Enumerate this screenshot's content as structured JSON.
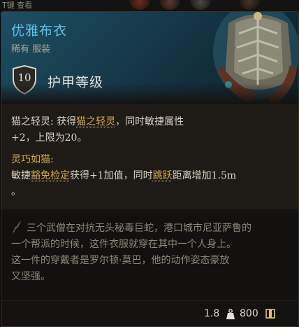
{
  "hint": {
    "key_text": "T键 查看"
  },
  "item": {
    "name": "优雅布衣",
    "rarity_type": "稀有 服装",
    "armor_class_value": "10",
    "armor_class_label": "护甲等级"
  },
  "properties": [
    {
      "title": "猫之轻灵:",
      "line1_pre": "获得",
      "line1_highlight": "猫之轻灵",
      "line1_post": "，同时敏捷属性",
      "line2": "+2，上限为20。"
    },
    {
      "title": "灵巧如猫:",
      "line1_pre": "敏捷",
      "line1_highlight": "豁免检定",
      "line1_mid": "获得+1加值，同时",
      "line1_highlight2": "跳跃",
      "line1_post": "距离增加1.5m",
      "line2": "。"
    }
  ],
  "lore": {
    "lines": [
      "三个武僧在对抗无头秘毒巨蛇，港口城市尼亚萨鲁的",
      "一个帮派的时候，这件衣服就穿在其中一个人身上。",
      "这一件的穿戴者是罗尔顿·莫巴，他的动作姿态豪放",
      "又坚强。"
    ]
  },
  "footer": {
    "weight": "1.8",
    "weight_icon": "weight-icon",
    "price": "800",
    "price_icon": "gold-coin-icon"
  },
  "colors": {
    "title": "#5fc0ec",
    "highlight": "#d4a94d",
    "header_bg": "#1d4e63",
    "text": "#d8d2c2",
    "lore_text": "#8c8679"
  }
}
